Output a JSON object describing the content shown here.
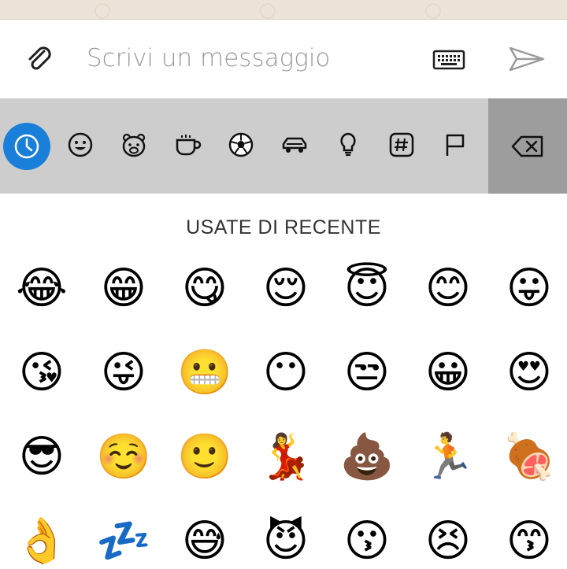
{
  "composer": {
    "placeholder": "Scrivi un messaggio",
    "attach_icon": "paperclip-icon",
    "keyboard_icon": "keyboard-icon",
    "send_icon": "send-icon"
  },
  "categories": [
    {
      "name": "recent",
      "icon": "clock-icon",
      "active": true
    },
    {
      "name": "smileys",
      "icon": "smiley-icon",
      "active": false
    },
    {
      "name": "animals",
      "icon": "bear-icon",
      "active": false
    },
    {
      "name": "food",
      "icon": "cup-icon",
      "active": false
    },
    {
      "name": "activity",
      "icon": "soccer-ball-icon",
      "active": false
    },
    {
      "name": "travel",
      "icon": "car-icon",
      "active": false
    },
    {
      "name": "objects",
      "icon": "lightbulb-icon",
      "active": false
    },
    {
      "name": "symbols",
      "icon": "hashtag-icon",
      "active": false
    },
    {
      "name": "flags",
      "icon": "flag-icon",
      "active": false
    }
  ],
  "backspace_icon": "backspace-icon",
  "section": {
    "title": "USATE DI RECENTE"
  },
  "emojis": [
    [
      "😂",
      "😁",
      "😋",
      "😌",
      "😇",
      "😊",
      "😛"
    ],
    [
      "😘",
      "😜",
      "😬",
      "😶",
      "😒",
      "😀",
      "😍"
    ],
    [
      "😎",
      "☺️",
      "🙂",
      "💃",
      "💩",
      "🏃",
      "🍖"
    ],
    [
      "👌",
      "💤",
      "😅",
      "😈",
      "😗",
      "😣",
      "😙"
    ]
  ],
  "colors": {
    "accent": "#1a7fd8",
    "category_bar": "#cdcdcd",
    "backspace_bg": "#9d9d9d",
    "placeholder": "#9a9a9a"
  }
}
